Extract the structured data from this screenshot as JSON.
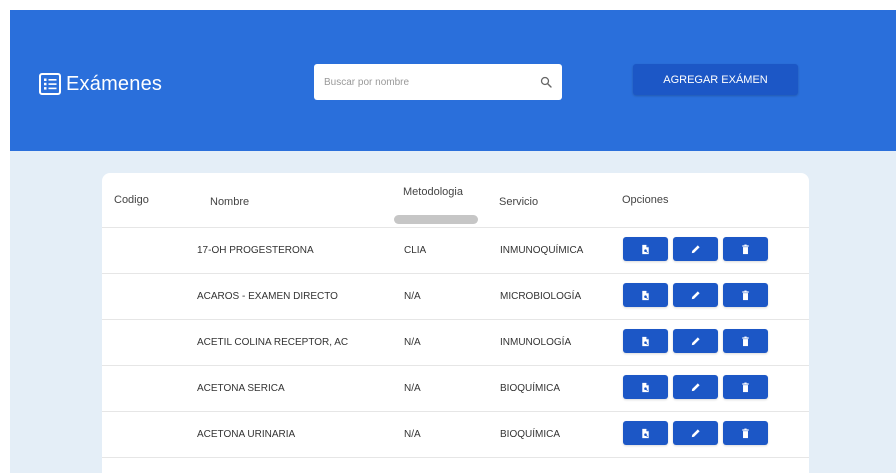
{
  "header": {
    "title": "Exámenes",
    "search_placeholder": "Buscar por nombre",
    "search_value": "",
    "add_button_label": "AGREGAR EXÁMEN"
  },
  "table": {
    "columns": [
      "Codigo",
      "Nombre",
      "Metodologia",
      "Servicio",
      "Opciones"
    ],
    "rows": [
      {
        "codigo": "",
        "nombre": "17-OH PROGESTERONA",
        "metodologia": "CLIA",
        "servicio": "INMUNOQUÍMICA"
      },
      {
        "codigo": "",
        "nombre": "ACAROS - EXAMEN DIRECTO",
        "metodologia": "N/A",
        "servicio": "MICROBIOLOGÍA"
      },
      {
        "codigo": "",
        "nombre": "ACETIL COLINA RECEPTOR, AC",
        "metodologia": "N/A",
        "servicio": "INMUNOLOGÍA"
      },
      {
        "codigo": "",
        "nombre": "ACETONA SERICA",
        "metodologia": "N/A",
        "servicio": "BIOQUÍMICA"
      },
      {
        "codigo": "",
        "nombre": "ACETONA URINARIA",
        "metodologia": "N/A",
        "servicio": "BIOQUÍMICA"
      }
    ]
  },
  "icons": {
    "brand": "list-icon",
    "search": "search-icon",
    "row_actions": [
      "document-icon",
      "pencil-icon",
      "trash-icon"
    ]
  },
  "colors": {
    "header_bg": "#2a6fdb",
    "page_bg": "#e4eef7",
    "button": "#1c57c6"
  }
}
